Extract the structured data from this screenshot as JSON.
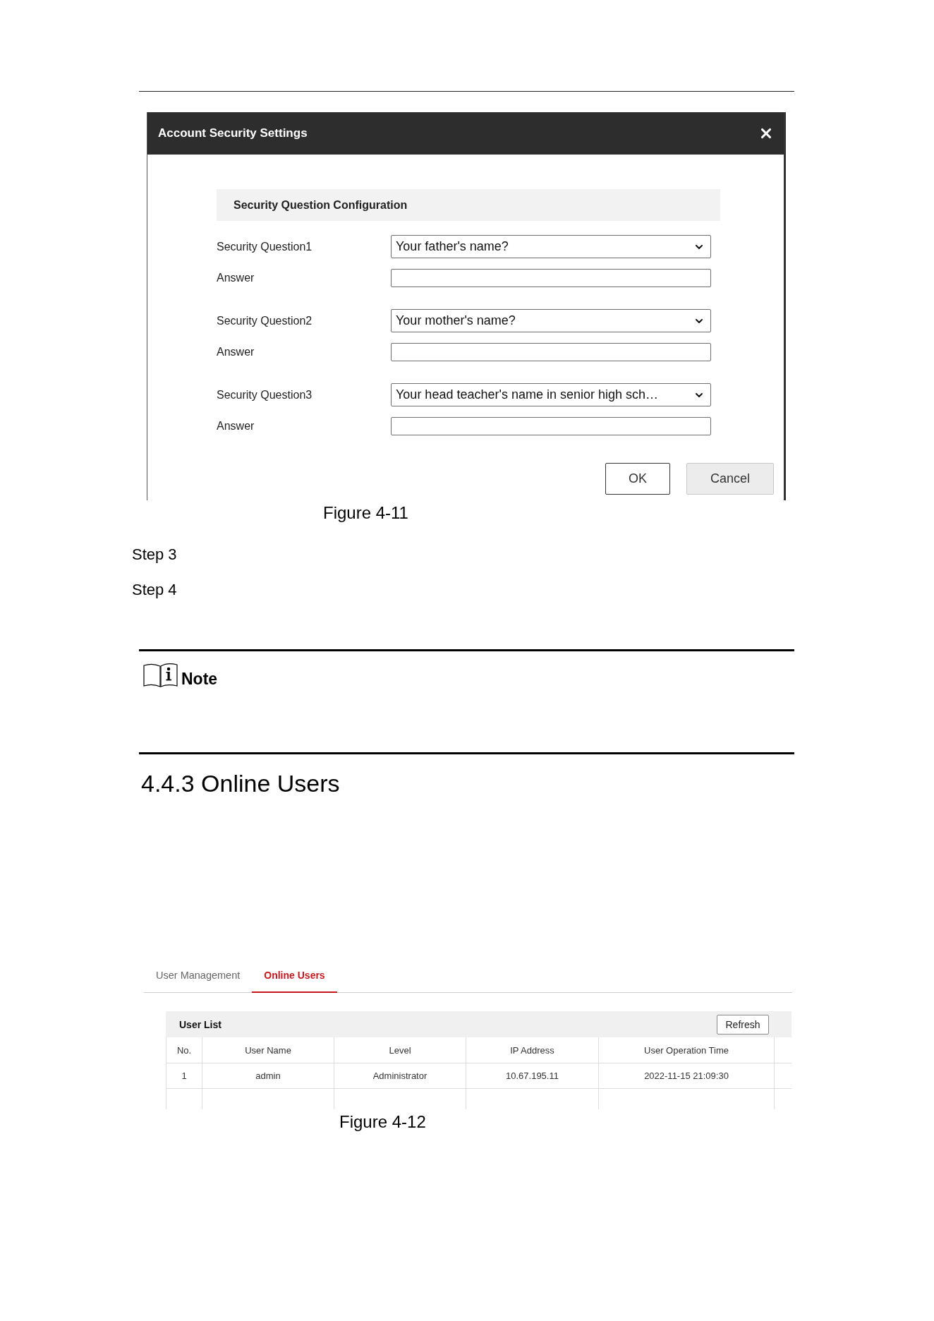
{
  "security_dialog_figure": {
    "dialog": {
      "title": "Account Security Settings",
      "section_title": "Security Question Configuration",
      "questions": [
        {
          "label": "Security Question1",
          "selected_option": "Your father's name?",
          "answer_label": "Answer"
        },
        {
          "label": "Security Question2",
          "selected_option": "Your mother's name?",
          "answer_label": "Answer"
        },
        {
          "label": "Security Question3",
          "selected_option": "Your head teacher's name in senior high sch…",
          "answer_label": "Answer"
        }
      ],
      "buttons": [
        {
          "label": "OK",
          "kind": "outlined"
        },
        {
          "label": "Cancel",
          "kind": "filled"
        }
      ]
    },
    "caption": "Figure 4-11"
  },
  "steps": [
    "Step 3",
    "Step 4"
  ],
  "note": {
    "label": "Note"
  },
  "section_heading": "4.4.3 Online Users",
  "online_users_figure": {
    "tabs": [
      {
        "label": "User Management",
        "selected": false
      },
      {
        "label": "Online Users",
        "selected": true
      }
    ],
    "panel": {
      "title": "User List",
      "refresh_button": "Refresh",
      "table": {
        "columns": [
          "No.",
          "User Name",
          "Level",
          "IP Address",
          "User Operation Time"
        ],
        "rows": [
          [
            "1",
            "admin",
            "Administrator",
            "10.67.195.11",
            "2022-11-15 21:09:30"
          ]
        ]
      }
    },
    "caption": "Figure 4-12"
  }
}
